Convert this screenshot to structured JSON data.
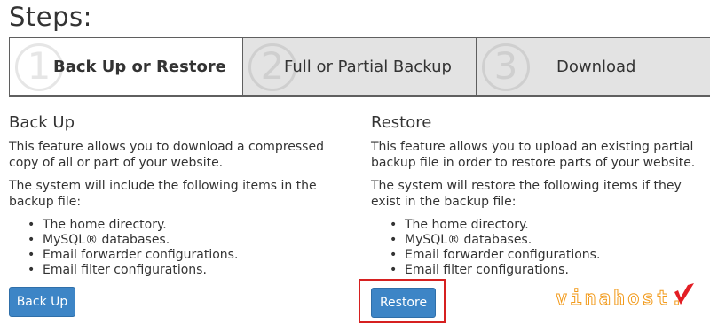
{
  "page": {
    "title": "Steps:"
  },
  "steps": [
    {
      "number": "1",
      "label": "Back Up or Restore"
    },
    {
      "number": "2",
      "label": "Full or Partial Backup"
    },
    {
      "number": "3",
      "label": "Download"
    }
  ],
  "backup": {
    "heading": "Back Up",
    "description": "This feature allows you to download a compressed copy of all or part of your website.",
    "includes_intro": "The system will include the following items in the backup file:",
    "items": [
      "The home directory.",
      "MySQL® databases.",
      "Email forwarder configurations.",
      "Email filter configurations."
    ],
    "button_label": "Back Up"
  },
  "restore": {
    "heading": "Restore",
    "description": "This feature allows you to upload an existing partial backup file in order to restore parts of your website.",
    "includes_intro": "The system will restore the following items if they exist in the backup file:",
    "items": [
      "The home directory.",
      "MySQL® databases.",
      "Email forwarder configurations.",
      "Email filter configurations."
    ],
    "button_label": "Restore"
  },
  "watermark": {
    "text": "vinahost."
  },
  "colors": {
    "button": "#3d85c6",
    "active_step": "#ffffff",
    "inactive_step": "#e3e3e3",
    "highlight": "#d62020",
    "watermark": "#f29a1a"
  }
}
